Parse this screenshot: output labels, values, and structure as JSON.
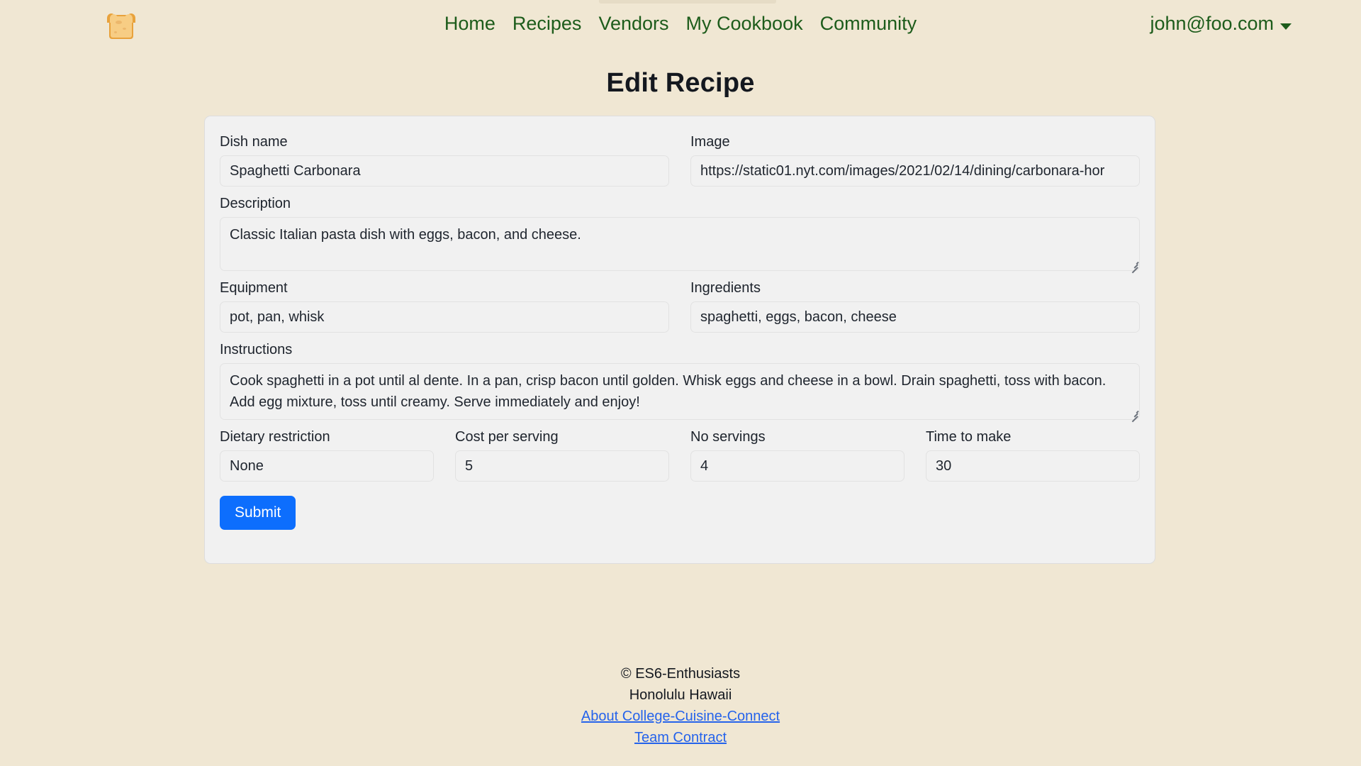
{
  "navbar": {
    "brand_icon": "toast-bread-icon",
    "links": [
      {
        "label": "Home"
      },
      {
        "label": "Recipes"
      },
      {
        "label": "Vendors"
      },
      {
        "label": "My Cookbook"
      },
      {
        "label": "Community"
      }
    ],
    "user": {
      "email": "john@foo.com",
      "caret_icon": "chevron-down-icon"
    },
    "link_color": "#1d5c1b"
  },
  "page": {
    "title": "Edit Recipe",
    "background_color": "#f0e7d3"
  },
  "form": {
    "dish_name": {
      "label": "Dish name",
      "value": "Spaghetti Carbonara",
      "placeholder": "Dish name"
    },
    "image": {
      "label": "Image",
      "value": "https://static01.nyt.com/images/2021/02/14/dining/carbonara-hor",
      "placeholder": "Image"
    },
    "description": {
      "label": "Description",
      "value": "Classic Italian pasta dish with eggs, bacon, and cheese.",
      "placeholder": "Description"
    },
    "equipment": {
      "label": "Equipment",
      "value": "pot, pan, whisk",
      "placeholder": "Equipment"
    },
    "ingredients": {
      "label": "Ingredients",
      "value": "spaghetti, eggs, bacon, cheese",
      "placeholder": "Ingredients"
    },
    "instructions": {
      "label": "Instructions",
      "value": "Cook spaghetti in a pot until al dente. In a pan, crisp bacon until golden. Whisk eggs and cheese in a bowl. Drain spaghetti, toss with bacon. Add egg mixture, toss until creamy. Serve immediately and enjoy!",
      "placeholder": "Instructions"
    },
    "dietary_restriction": {
      "label": "Dietary restriction",
      "value": "None",
      "placeholder": "Dietary restriction"
    },
    "cost_per_serving": {
      "label": "Cost per serving",
      "value": "5",
      "placeholder": "Cost per serving"
    },
    "no_servings": {
      "label": "No servings",
      "value": "4",
      "placeholder": "No servings"
    },
    "time_to_make": {
      "label": "Time to make",
      "value": "30",
      "placeholder": "Time to make"
    },
    "submit": {
      "label": "Submit",
      "color": "#0d6efd"
    }
  },
  "footer": {
    "copyright": "© ES6-Enthusiasts",
    "location": "Honolulu Hawaii",
    "about_link": "About College-Cuisine-Connect",
    "team_link": "Team Contract",
    "link_color": "#2563eb"
  }
}
